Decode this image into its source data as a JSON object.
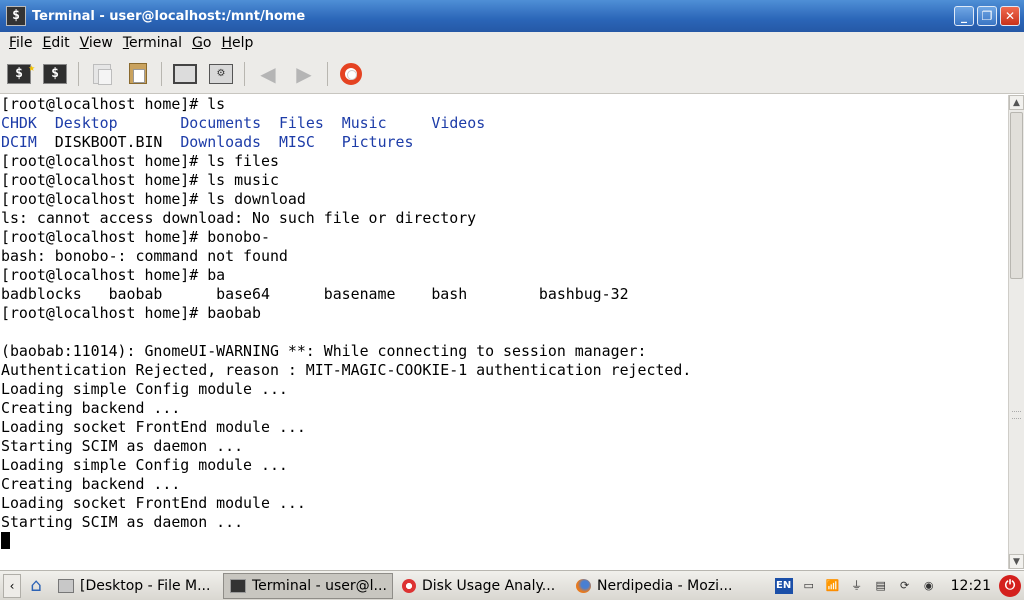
{
  "window": {
    "title": "Terminal - user@localhost:/mnt/home",
    "app_icon_glyph": "$"
  },
  "menubar": {
    "items": [
      "File",
      "Edit",
      "View",
      "Terminal",
      "Go",
      "Help"
    ]
  },
  "toolbar": {
    "icons": [
      "new-terminal-icon",
      "new-tab-icon",
      "copy-icon",
      "paste-icon",
      "fullscreen-icon",
      "preferences-icon",
      "back-arrow-icon",
      "forward-arrow-icon",
      "help-lifebuoy-icon"
    ]
  },
  "terminal": {
    "lines": [
      [
        {
          "t": "[root@localhost home]# ls",
          "c": "n"
        }
      ],
      [
        {
          "t": "CHDK",
          "c": "d"
        },
        {
          "t": "  ",
          "c": "n"
        },
        {
          "t": "Desktop",
          "c": "d"
        },
        {
          "t": "       ",
          "c": "n"
        },
        {
          "t": "Documents",
          "c": "d"
        },
        {
          "t": "  ",
          "c": "n"
        },
        {
          "t": "Files",
          "c": "d"
        },
        {
          "t": "  ",
          "c": "n"
        },
        {
          "t": "Music",
          "c": "d"
        },
        {
          "t": "     ",
          "c": "n"
        },
        {
          "t": "Videos",
          "c": "d"
        }
      ],
      [
        {
          "t": "DCIM",
          "c": "d"
        },
        {
          "t": "  DISKBOOT.BIN  ",
          "c": "n"
        },
        {
          "t": "Downloads",
          "c": "d"
        },
        {
          "t": "  ",
          "c": "n"
        },
        {
          "t": "MISC",
          "c": "d"
        },
        {
          "t": "   ",
          "c": "n"
        },
        {
          "t": "Pictures",
          "c": "d"
        }
      ],
      [
        {
          "t": "[root@localhost home]# ls files",
          "c": "n"
        }
      ],
      [
        {
          "t": "[root@localhost home]# ls music",
          "c": "n"
        }
      ],
      [
        {
          "t": "[root@localhost home]# ls download",
          "c": "n"
        }
      ],
      [
        {
          "t": "ls: cannot access download: No such file or directory",
          "c": "n"
        }
      ],
      [
        {
          "t": "[root@localhost home]# bonobo-",
          "c": "n"
        }
      ],
      [
        {
          "t": "bash: bonobo-: command not found",
          "c": "n"
        }
      ],
      [
        {
          "t": "[root@localhost home]# ba",
          "c": "n"
        }
      ],
      [
        {
          "t": "badblocks   baobab      base64      basename    bash        bashbug-32",
          "c": "n"
        }
      ],
      [
        {
          "t": "[root@localhost home]# baobab",
          "c": "n"
        }
      ],
      [
        {
          "t": "",
          "c": "n"
        }
      ],
      [
        {
          "t": "(baobab:11014): GnomeUI-WARNING **: While connecting to session manager:",
          "c": "n"
        }
      ],
      [
        {
          "t": "Authentication Rejected, reason : MIT-MAGIC-COOKIE-1 authentication rejected.",
          "c": "n"
        }
      ],
      [
        {
          "t": "Loading simple Config module ...",
          "c": "n"
        }
      ],
      [
        {
          "t": "Creating backend ...",
          "c": "n"
        }
      ],
      [
        {
          "t": "Loading socket FrontEnd module ...",
          "c": "n"
        }
      ],
      [
        {
          "t": "Starting SCIM as daemon ...",
          "c": "n"
        }
      ],
      [
        {
          "t": "Loading simple Config module ...",
          "c": "n"
        }
      ],
      [
        {
          "t": "Creating backend ...",
          "c": "n"
        }
      ],
      [
        {
          "t": "Loading socket FrontEnd module ...",
          "c": "n"
        }
      ],
      [
        {
          "t": "Starting SCIM as daemon ...",
          "c": "n"
        }
      ]
    ],
    "dir_color": "#1d3ca8"
  },
  "taskbar": {
    "tasks": [
      {
        "label": "[Desktop - File M...",
        "icon": "file-manager-icon",
        "active": false
      },
      {
        "label": "Terminal - user@l...",
        "icon": "terminal-icon",
        "active": true
      },
      {
        "label": "Disk Usage Analy...",
        "icon": "disk-usage-icon",
        "active": false
      },
      {
        "label": "Nerdipedia - Mozi...",
        "icon": "firefox-icon",
        "active": false
      }
    ],
    "tray": {
      "lang": "EN",
      "clock": "12:21"
    }
  },
  "colors": {
    "titlebar": "#2b66b8",
    "chrome_bg": "#ecebe8",
    "close_button": "#c8331b"
  }
}
